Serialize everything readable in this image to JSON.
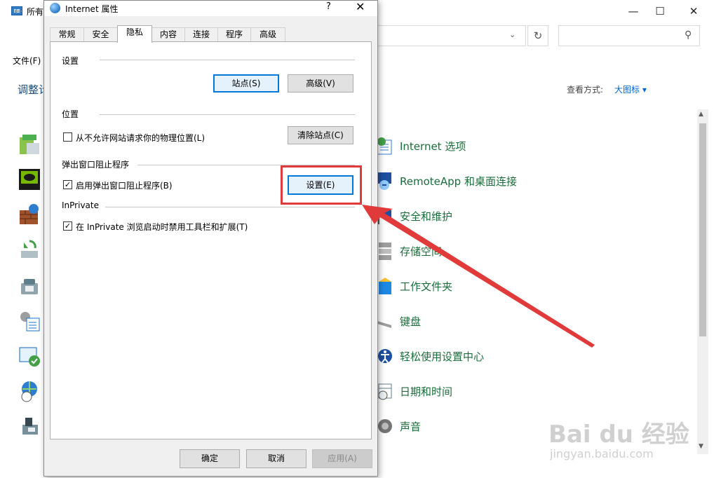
{
  "background_window": {
    "title": "所有",
    "menu_file": "文件(F)",
    "heading": "调整计算机的设置",
    "view_by_label": "查看方式:",
    "view_by_value": "大图标 ▾",
    "items": [
      {
        "label": "Internet 选项"
      },
      {
        "label": "RemoteApp 和桌面连接"
      },
      {
        "label": "安全和维护"
      },
      {
        "label": "存储空间"
      },
      {
        "label": "工作文件夹"
      },
      {
        "label": "键盘"
      },
      {
        "label": "轻松使用设置中心"
      },
      {
        "label": "日期和时间"
      },
      {
        "label": "声音"
      }
    ]
  },
  "dialog": {
    "title": "Internet 属性",
    "help": "?",
    "close": "✕",
    "tabs": [
      {
        "label": "常规"
      },
      {
        "label": "安全"
      },
      {
        "label": "隐私"
      },
      {
        "label": "内容"
      },
      {
        "label": "连接"
      },
      {
        "label": "程序"
      },
      {
        "label": "高级"
      }
    ],
    "active_tab": "隐私",
    "settings_group": "设置",
    "sites_button": "站点(S)",
    "advanced_button": "高级(V)",
    "location_group": "位置",
    "location_checkbox": "从不允许网站请求你的物理位置(L)",
    "location_checked": false,
    "clear_sites_button": "清除站点(C)",
    "popup_group": "弹出窗口阻止程序",
    "popup_checkbox": "启用弹出窗口阻止程序(B)",
    "popup_checked": true,
    "popup_settings_button": "设置(E)",
    "inprivate_group": "InPrivate",
    "inprivate_checkbox": "在 InPrivate 浏览启动时禁用工具栏和扩展(T)",
    "inprivate_checked": true,
    "ok_button": "确定",
    "cancel_button": "取消",
    "apply_button": "应用(A)"
  },
  "watermark": {
    "logo": "Bai du 经验",
    "url": "jingyan.baidu.com"
  },
  "colors": {
    "annotation": "#e03a3a",
    "link_green": "#1a6d3a",
    "accent": "#0078d7"
  }
}
